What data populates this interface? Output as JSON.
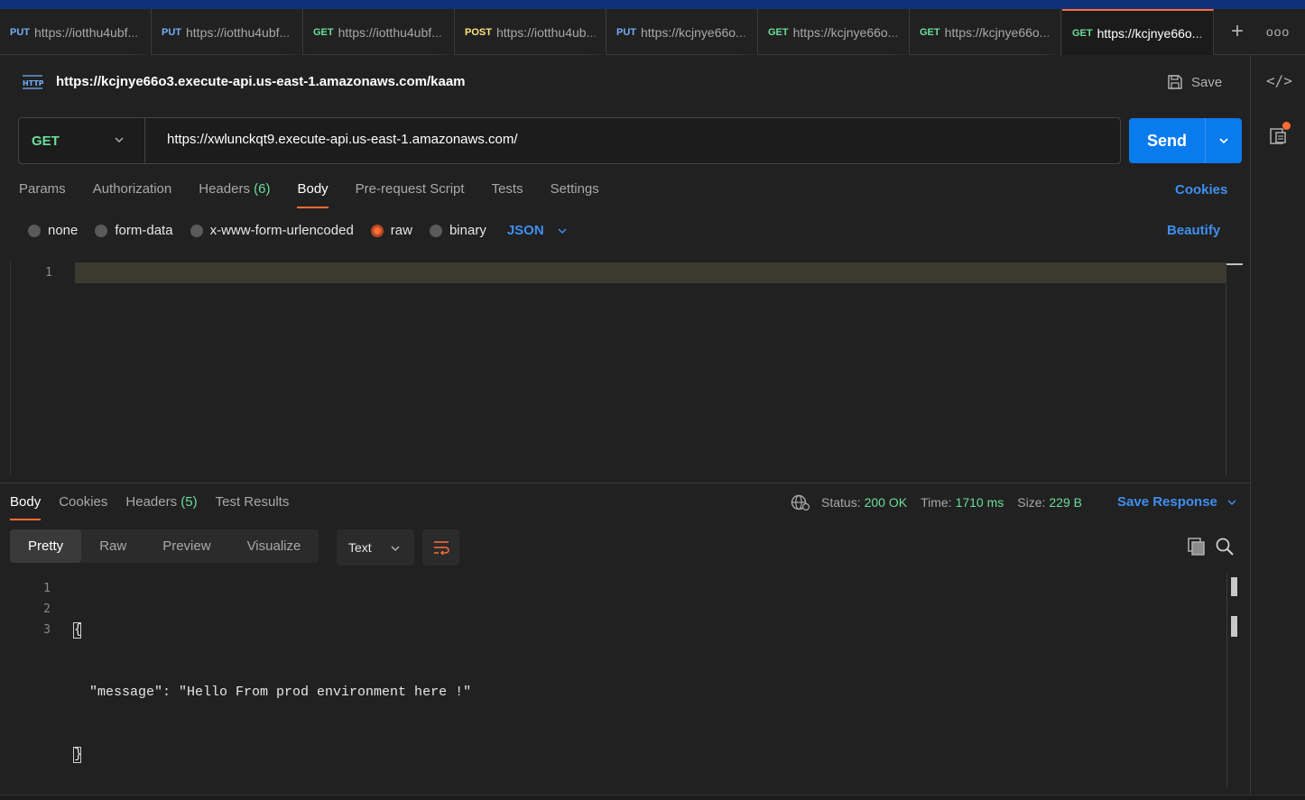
{
  "tabs": [
    {
      "method": "PUT",
      "url": "https://iotthu4ubf..."
    },
    {
      "method": "PUT",
      "url": "https://iotthu4ubf..."
    },
    {
      "method": "GET",
      "url": "https://iotthu4ubf..."
    },
    {
      "method": "POST",
      "url": "https://iotthu4ub..."
    },
    {
      "method": "PUT",
      "url": "https://kcjnye66o..."
    },
    {
      "method": "GET",
      "url": "https://kcjnye66o..."
    },
    {
      "method": "GET",
      "url": "https://kcjnye66o..."
    },
    {
      "method": "GET",
      "url": "https://kcjnye66o..."
    }
  ],
  "tab_plus": "+",
  "tab_more": "ooo",
  "request": {
    "title": "https://kcjnye66o3.execute-api.us-east-1.amazonaws.com/kaam",
    "save_label": "Save",
    "method": "GET",
    "url": "https://xwlunckqt9.execute-api.us-east-1.amazonaws.com/",
    "send_label": "Send"
  },
  "request_tabs": {
    "params": "Params",
    "authorization": "Authorization",
    "headers": "Headers",
    "headers_count": "(6)",
    "body": "Body",
    "prerequest": "Pre-request Script",
    "tests": "Tests",
    "settings": "Settings",
    "cookies": "Cookies"
  },
  "body_types": {
    "none": "none",
    "form_data": "form-data",
    "urlencoded": "x-www-form-urlencoded",
    "raw": "raw",
    "binary": "binary",
    "selected": "raw",
    "format": "JSON",
    "beautify": "Beautify"
  },
  "editor": {
    "line_numbers": [
      "1"
    ],
    "content": ""
  },
  "response_tabs": {
    "body": "Body",
    "cookies": "Cookies",
    "headers": "Headers",
    "headers_count": "(5)",
    "test_results": "Test Results"
  },
  "response_status": {
    "status_label": "Status:",
    "status_value": "200 OK",
    "time_label": "Time:",
    "time_value": "1710 ms",
    "size_label": "Size:",
    "size_value": "229 B",
    "save_response": "Save Response"
  },
  "response_view": {
    "pretty": "Pretty",
    "raw": "Raw",
    "preview": "Preview",
    "visualize": "Visualize",
    "format": "Text"
  },
  "response_body": {
    "line_numbers": [
      "1",
      "2",
      "3"
    ],
    "line1": "{",
    "line2": "  \"message\": \"Hello From prod environment here !\"",
    "line3": "}"
  },
  "colors": {
    "accent": "#ff6c37",
    "link_blue": "#3f8ff0",
    "send_blue": "#097bed",
    "get_green": "#6bdd9a",
    "put_blue": "#74aef6",
    "post_yellow": "#ffe47e",
    "top_stripe": "#10317a"
  },
  "icons": [
    "http-icon",
    "save-icon",
    "chevron-down-icon",
    "code-icon",
    "documentation-icon",
    "globe-icon",
    "wrap-lines-icon",
    "copy-icon",
    "search-icon",
    "plus-icon",
    "more-icon"
  ]
}
